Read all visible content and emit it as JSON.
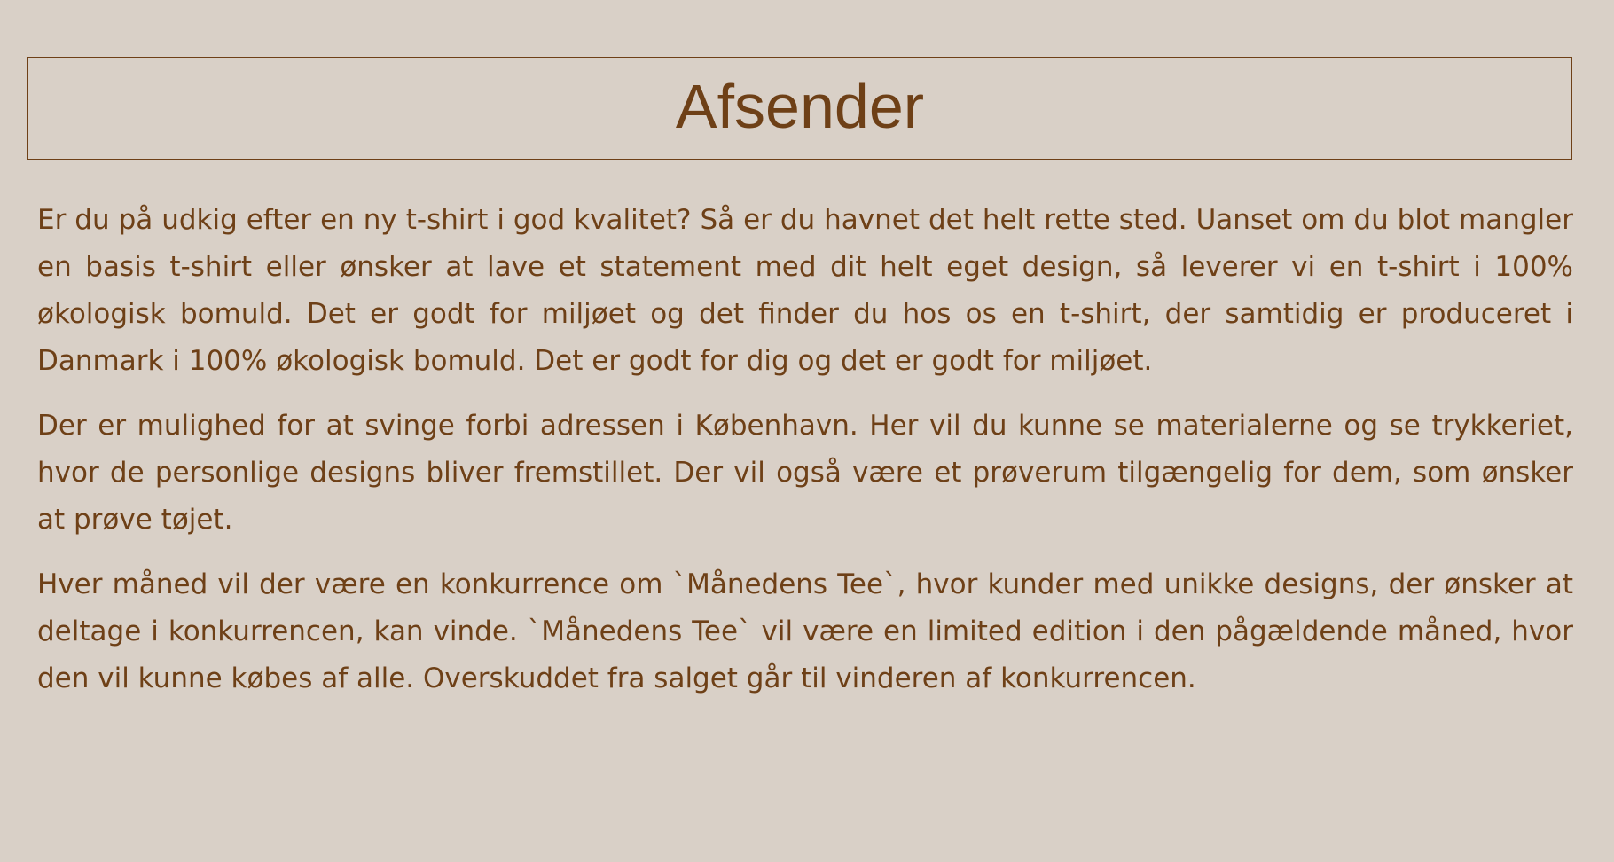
{
  "slide": {
    "title": "Afsender",
    "paragraphs": [
      "Er du på udkig efter en ny t-shirt i god kvalitet? Så er du havnet det helt rette sted. Uanset om du blot mangler en basis t-shirt eller ønsker at lave et statement med dit helt eget design, så leverer vi en t-shirt i 100% økologisk bomuld. Det er godt for miljøet og det finder du hos os en t-shirt, der samtidig er produceret i Danmark i 100% økologisk bomuld. Det er godt for dig og det er godt for miljøet.",
      "Der er mulighed for at svinge forbi adressen i København. Her vil du kunne se materialerne og se trykkeriet, hvor de personlige designs bliver fremstillet. Der vil også være et prøverum tilgængelig for dem, som ønsker at prøve tøjet.",
      "Hver måned vil der være en konkurrence om `Månedens Tee`, hvor kunder med unikke designs, der ønsker at deltage i konkurrencen, kan vinde. `Månedens Tee` vil være en limited edition i den pågældende måned, hvor den vil kunne købes af alle. Overskuddet fra salget går til vinderen af konkurrencen."
    ]
  },
  "colors": {
    "background": "#d9d0c7",
    "text": "#6e4017"
  }
}
